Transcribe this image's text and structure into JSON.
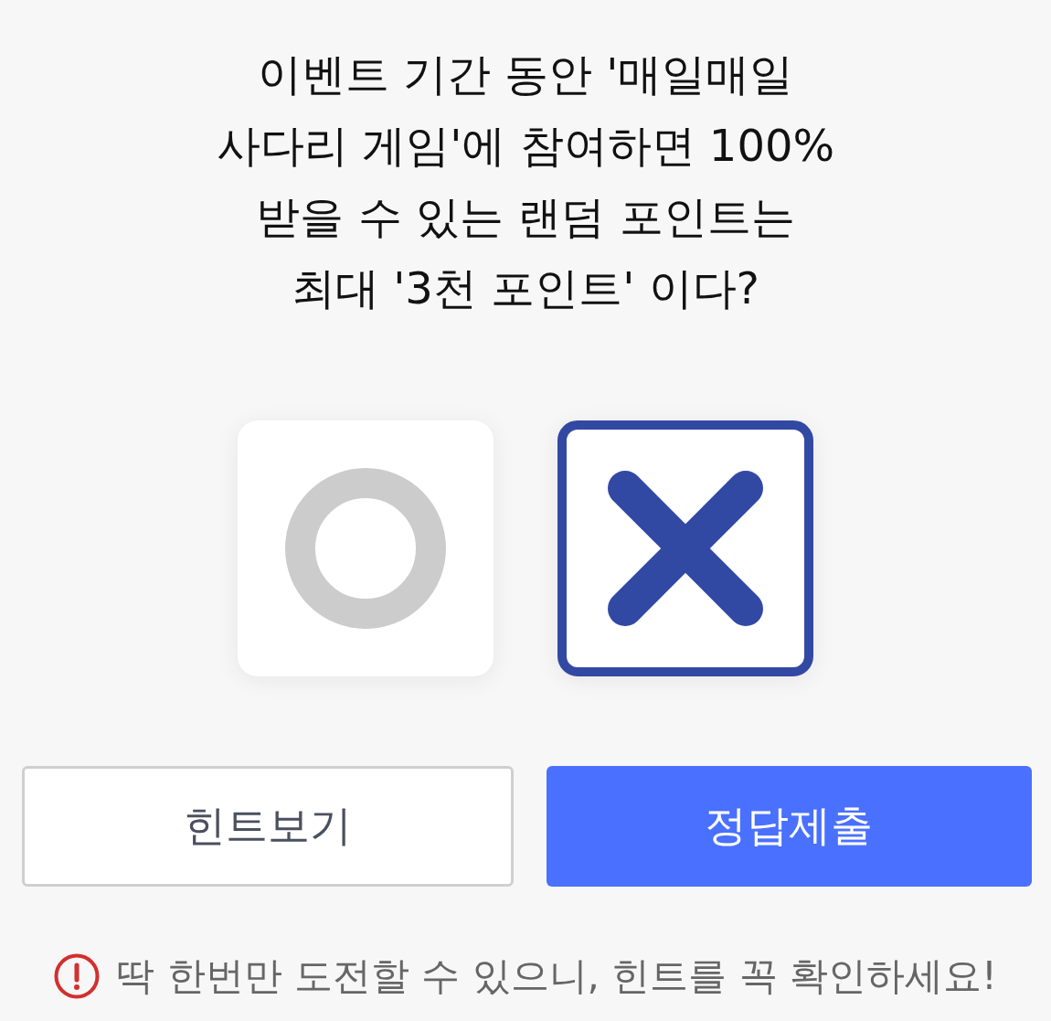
{
  "question": "이벤트 기간 동안 '매일매일\n사다리 게임'에 참여하면 100%\n받을 수 있는 랜덤 포인트는\n최대 '3천 포인트' 이다?",
  "choices": [
    {
      "kind": "o",
      "selected": false
    },
    {
      "kind": "x",
      "selected": true
    }
  ],
  "buttons": [
    {
      "kind": "secondary",
      "label": "힌트보기"
    },
    {
      "kind": "primary",
      "label": "정답제출"
    }
  ],
  "notice": {
    "text": "딱 한번만 도전할 수 있으니, 힌트를 꼭 확인하세요!"
  }
}
